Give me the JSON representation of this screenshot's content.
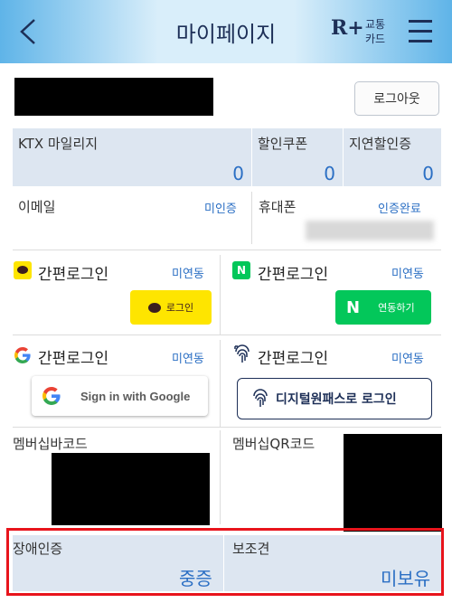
{
  "header": {
    "title": "마이페이지",
    "logo_mark": "R+",
    "logo_text_1": "교통",
    "logo_text_2": "카드",
    "back_icon": "chevron-left-icon",
    "menu_icon": "hamburger-menu-icon"
  },
  "account": {
    "logout_label": "로그아웃"
  },
  "stats": [
    {
      "label": "KTX 마일리지",
      "value": "0"
    },
    {
      "label": "할인쿠폰",
      "value": "0"
    },
    {
      "label": "지연할인증",
      "value": "0"
    }
  ],
  "contact": {
    "email_label": "이메일",
    "email_status": "미인증",
    "phone_label": "휴대폰",
    "phone_status": "인증완료"
  },
  "simple_login": {
    "kakao": {
      "label": "간편로그인",
      "status": "미연동",
      "button": "로그인"
    },
    "naver": {
      "label": "간편로그인",
      "status": "미연동",
      "button_mark": "N",
      "button": "연동하기"
    },
    "google": {
      "label": "간편로그인",
      "status": "미연동",
      "button": "Sign in with Google"
    },
    "digital_onepass": {
      "label": "간편로그인",
      "status": "미연동",
      "button": "디지털원패스로 로그인"
    }
  },
  "membership": {
    "barcode_label": "멤버십바코드",
    "qr_label": "멤버십QR코드"
  },
  "welfare": {
    "disability_label": "장애인증",
    "disability_value": "중증",
    "guide_dog_label": "보조견",
    "guide_dog_value": "미보유"
  },
  "colors": {
    "accent_blue": "#2b6fc4",
    "navy": "#1d2f57",
    "kakao_yellow": "#fee500",
    "naver_green": "#03c75a",
    "highlight_red": "#e8141c",
    "panel_bg": "#dde6f1"
  }
}
